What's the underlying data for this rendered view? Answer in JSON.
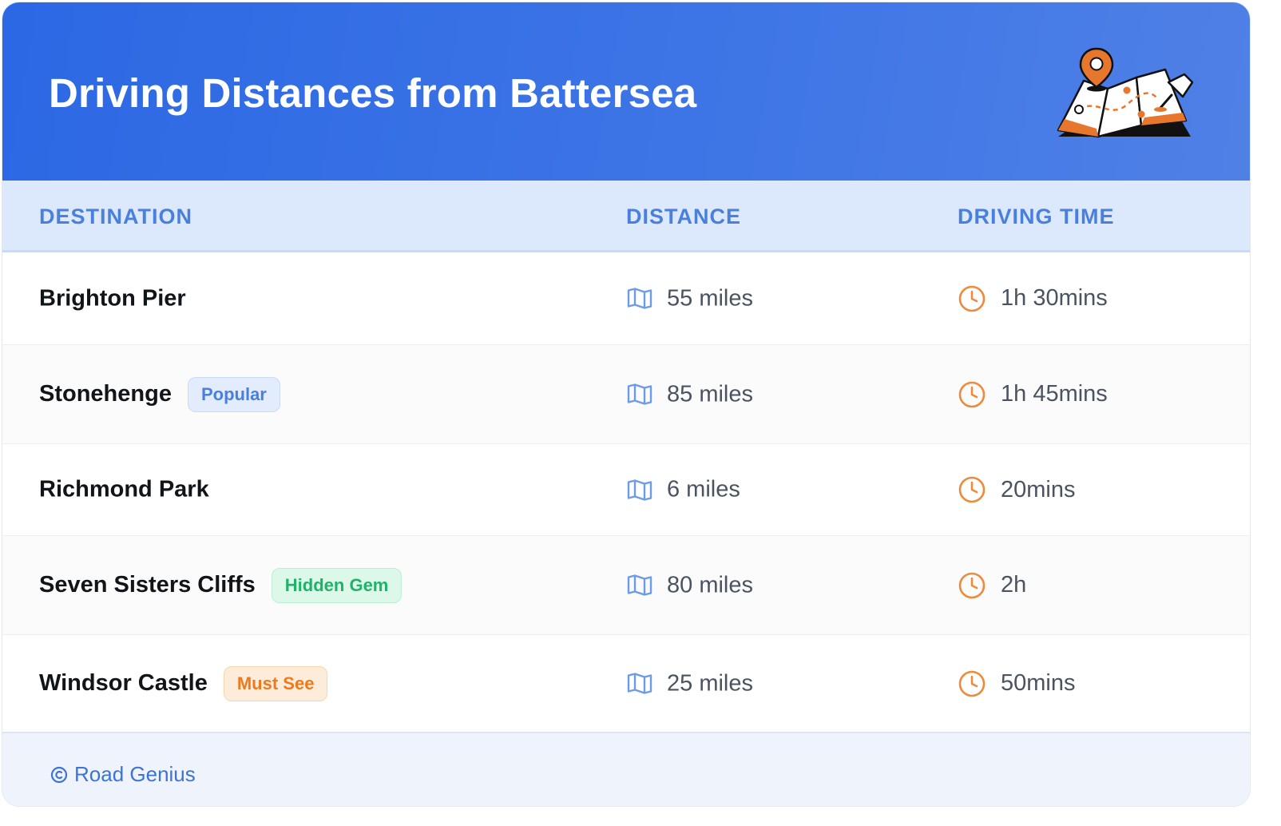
{
  "header": {
    "title": "Driving Distances from Battersea"
  },
  "table": {
    "columns": [
      "DESTINATION",
      "DISTANCE",
      "DRIVING TIME"
    ],
    "rows": [
      {
        "destination": "Brighton Pier",
        "badge": "",
        "distance": "55 miles",
        "time": "1h 30mins"
      },
      {
        "destination": "Stonehenge",
        "badge": "Popular",
        "distance": "85 miles",
        "time": "1h 45mins"
      },
      {
        "destination": "Richmond Park",
        "badge": "",
        "distance": "6 miles",
        "time": "20mins"
      },
      {
        "destination": "Seven Sisters Cliffs",
        "badge": "Hidden Gem",
        "distance": "80 miles",
        "time": "2h"
      },
      {
        "destination": "Windsor Castle",
        "badge": "Must See",
        "distance": "25 miles",
        "time": "50mins"
      }
    ]
  },
  "footer": {
    "brand": "Road Genius"
  },
  "icons": {
    "distance": "map-icon",
    "time": "clock-icon",
    "footer": "copyright-icon",
    "header": "map-pin-illustration"
  },
  "colors": {
    "header_bg": "#2c68e4",
    "accent_blue": "#4a7fdc",
    "accent_orange": "#ee8a3c",
    "badge_popular": "#4a7fdc",
    "badge_hidden_gem": "#20b26b",
    "badge_must_see": "#ee7a1e"
  }
}
